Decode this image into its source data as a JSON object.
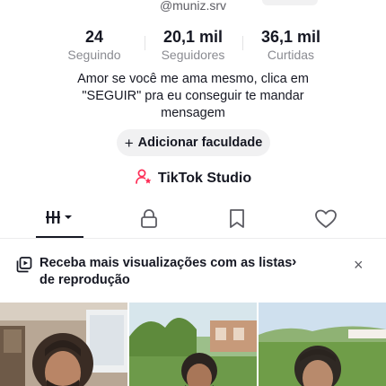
{
  "profile": {
    "username": "@muniz.srv",
    "stats": [
      {
        "value": "24",
        "label": "Seguindo"
      },
      {
        "value": "20,1 mil",
        "label": "Seguidores"
      },
      {
        "value": "36,1 mil",
        "label": "Curtidas"
      }
    ],
    "bio_lines": [
      "Amor se você me ama mesmo, clica em",
      "\"SEGUIR\" pra eu conseguir te mandar",
      "mensagem"
    ],
    "add_button_label": "Adicionar faculdade",
    "studio_label": "TikTok Studio"
  },
  "tabs": [
    {
      "icon": "grid-icon",
      "active": true
    },
    {
      "icon": "lock-icon",
      "active": false
    },
    {
      "icon": "bookmark-icon",
      "active": false
    },
    {
      "icon": "heart-icon",
      "active": false
    }
  ],
  "banner": {
    "line1": "Receba mais visualizações com as listas",
    "line2": "de reprodução",
    "chevron": "›",
    "close": "×"
  },
  "colors": {
    "text": "#161823",
    "muted": "#8a8b91",
    "accent": "#fe2c55",
    "pill_bg": "#f1f1f2"
  }
}
